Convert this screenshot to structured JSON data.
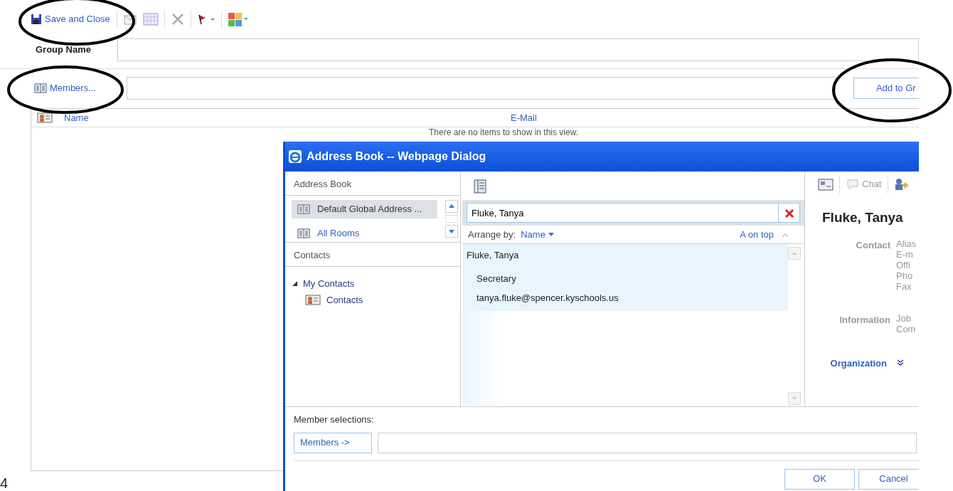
{
  "toolbar": {
    "save_button": "Save and Close"
  },
  "group_name": {
    "label": "Group Name"
  },
  "members": {
    "link": "Members...",
    "add_button": "Add to Gr"
  },
  "list": {
    "columns": [
      "Name",
      "E-Mail"
    ],
    "empty_message": "There are no items to show in this view."
  },
  "dialog": {
    "title": "Address Book -- Webpage Dialog",
    "address_book": {
      "heading": "Address Book",
      "books": [
        {
          "label": "Default Global Address ...",
          "selected": true
        },
        {
          "label": "All Rooms",
          "selected": false
        }
      ]
    },
    "contacts": {
      "heading": "Contacts",
      "tree": [
        {
          "label": "My Contacts",
          "expanded": true,
          "children": [
            {
              "label": "Contacts"
            }
          ]
        }
      ]
    },
    "search": {
      "value": "Fluke, Tanya"
    },
    "arrange": {
      "label": "Arrange by:",
      "field": "Name",
      "order": "A on top"
    },
    "results": [
      {
        "name": "Fluke, Tanya",
        "title": "Secretary",
        "email": "tanya.fluke@spencer.kyschools.us",
        "selected": true
      }
    ],
    "details": {
      "chat": "Chat",
      "name": "Fluke, Tanya",
      "sections": [
        {
          "kind": "fields",
          "label": "Contact",
          "fields": [
            "Alias",
            "E-m",
            "Offi",
            "Pho",
            "Fax"
          ]
        },
        {
          "kind": "fields",
          "label": "Information",
          "fields": [
            "Job",
            "Com"
          ]
        },
        {
          "kind": "expander",
          "label": "Organization"
        }
      ]
    },
    "member_selections": {
      "label": "Member selections:",
      "button": "Members ->"
    },
    "buttons": [
      "OK",
      "Cancel"
    ]
  },
  "page_number": "4"
}
